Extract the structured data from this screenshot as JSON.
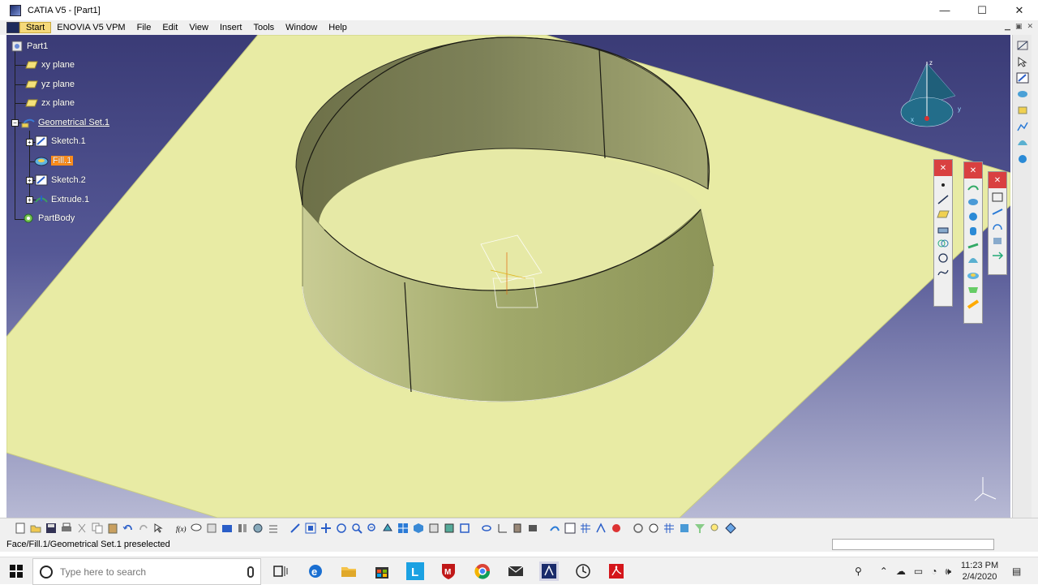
{
  "window": {
    "title": "CATIA V5 - [Part1]",
    "controls": {
      "minimize": "—",
      "maximize": "☐",
      "close": "✕"
    }
  },
  "menu": {
    "items": [
      "Start",
      "ENOVIA V5 VPM",
      "File",
      "Edit",
      "View",
      "Insert",
      "Tools",
      "Window",
      "Help"
    ],
    "active": "Start"
  },
  "tree": {
    "root": "Part1",
    "items": [
      {
        "label": "xy plane",
        "icon": "plane-icon"
      },
      {
        "label": "yz plane",
        "icon": "plane-icon"
      },
      {
        "label": "zx plane",
        "icon": "plane-icon"
      },
      {
        "label": "Geometrical Set.1",
        "icon": "geometrical-set-icon"
      },
      {
        "label": "Sketch.1",
        "icon": "sketch-icon"
      },
      {
        "label": "Fill.1",
        "icon": "fill-icon",
        "selected": true
      },
      {
        "label": "Sketch.2",
        "icon": "sketch-icon"
      },
      {
        "label": "Extrude.1",
        "icon": "extrude-icon"
      },
      {
        "label": "PartBody",
        "icon": "partbody-icon"
      }
    ]
  },
  "compass": {
    "z_label": "z",
    "x_label": "x",
    "y_label": "y"
  },
  "status": {
    "message": "Face/Fill.1/Geometrical Set.1 preselected",
    "command_input": ""
  },
  "taskbar": {
    "search_placeholder": "Type here to search",
    "apps": [
      "task-view-icon",
      "edge-icon",
      "file-explorer-icon",
      "store-icon",
      "l-app-icon",
      "mcafee-icon",
      "chrome-icon",
      "mail-icon",
      "catia-icon",
      "clock-app-icon",
      "acrobat-icon"
    ],
    "time": "11:23 PM",
    "date": "2/4/2020"
  },
  "colors": {
    "surface": "#e8eba4",
    "surface_edge": "#c9cc82",
    "cylinder_outer": "#a0a86a",
    "cylinder_inner": "#7d8158",
    "background_top": "#3a3b76",
    "background_bottom": "#b7b9d4",
    "selection": "#ff8c1a"
  }
}
